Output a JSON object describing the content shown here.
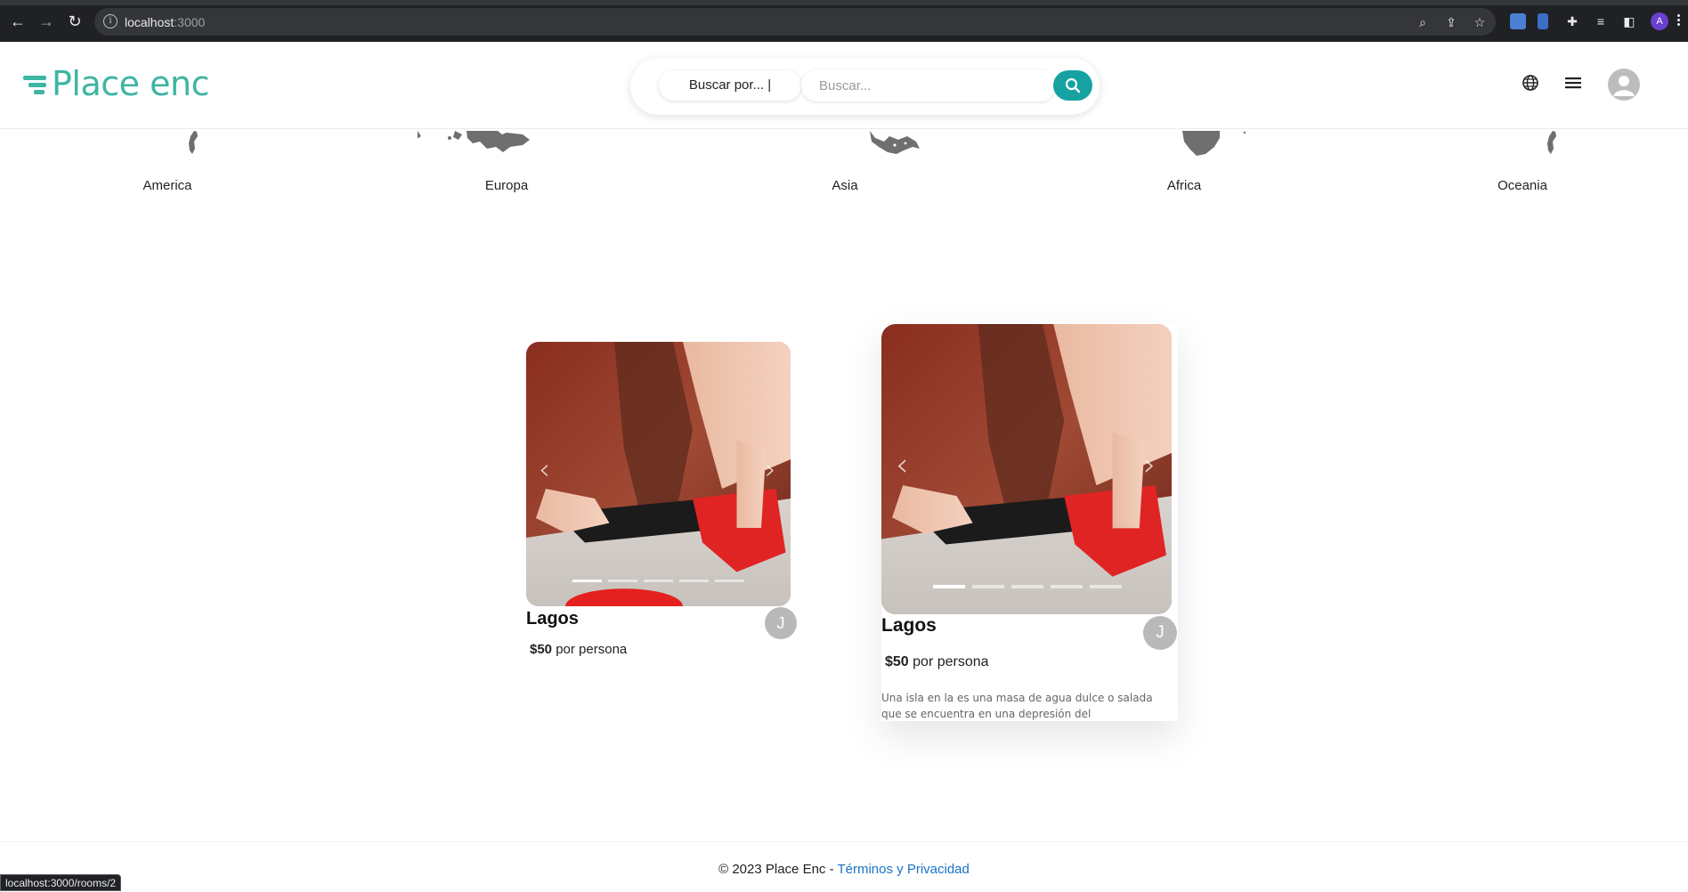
{
  "browser": {
    "url_host": "localhost",
    "url_port": ":3000",
    "profile_initial": "A"
  },
  "header": {
    "logo_text": "Place enc",
    "search_type_label": "Buscar por... |",
    "search_placeholder": "Buscar...",
    "brand_color": "#3fb5a3",
    "accent_color": "#17a2a2"
  },
  "continents": [
    {
      "label": "America"
    },
    {
      "label": "Europa"
    },
    {
      "label": "Asia"
    },
    {
      "label": "Africa"
    },
    {
      "label": "Oceania"
    }
  ],
  "cards": [
    {
      "title": "Lagos",
      "price": "$50",
      "price_suffix": "por persona",
      "host_initial": "J",
      "dots": 5,
      "active_dot": 0
    },
    {
      "title": "Lagos",
      "price": "$50",
      "price_suffix": "por persona",
      "host_initial": "J",
      "description": "Una isla en la es una masa de agua dulce o salada que se encuentra en una depresión del",
      "dots": 5,
      "active_dot": 0
    }
  ],
  "footer": {
    "copyright": "© 2023 Place Enc - ",
    "link_text": "Términos y Privacidad"
  },
  "status_bar": {
    "hover_url": "localhost:3000/rooms/2"
  }
}
